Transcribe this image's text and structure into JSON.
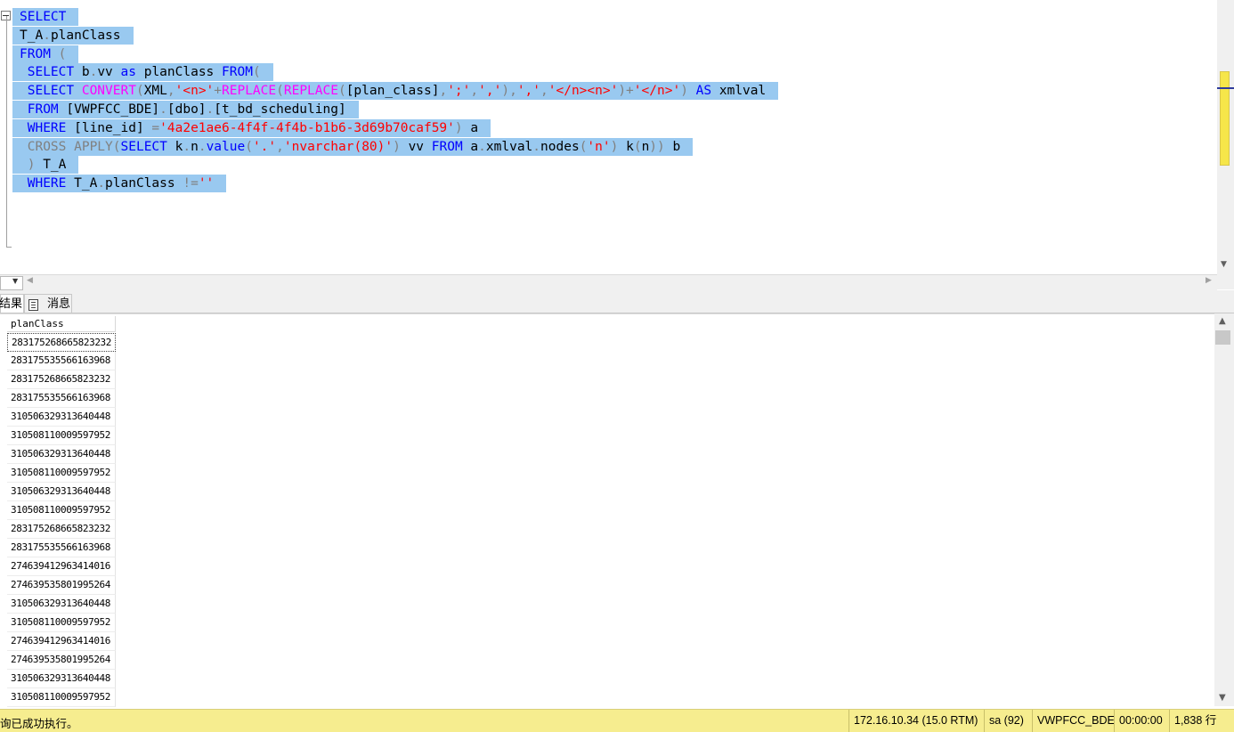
{
  "editor": {
    "lines": [
      [
        {
          "t": "SELECT",
          "c": "kw"
        }
      ],
      [
        {
          "t": "T_A",
          "c": ""
        },
        {
          "t": ".",
          "c": "gr"
        },
        {
          "t": "planClass",
          "c": ""
        }
      ],
      [
        {
          "t": "FROM",
          "c": "kw"
        },
        {
          "t": " (",
          "c": "gr"
        }
      ],
      [
        {
          "t": " SELECT",
          "c": "kw"
        },
        {
          "t": " b",
          "c": ""
        },
        {
          "t": ".",
          "c": "gr"
        },
        {
          "t": "vv ",
          "c": ""
        },
        {
          "t": "as",
          "c": "kw"
        },
        {
          "t": " planClass ",
          "c": ""
        },
        {
          "t": "FROM",
          "c": "kw"
        },
        {
          "t": "(",
          "c": "gr"
        }
      ],
      [
        {
          "t": " SELECT",
          "c": "kw"
        },
        {
          "t": " ",
          "c": ""
        },
        {
          "t": "CONVERT",
          "c": "fn"
        },
        {
          "t": "(",
          "c": "gr"
        },
        {
          "t": "XML",
          "c": ""
        },
        {
          "t": ",",
          "c": "gr"
        },
        {
          "t": "'<n>'",
          "c": "str"
        },
        {
          "t": "+",
          "c": "gr"
        },
        {
          "t": "REPLACE",
          "c": "fn"
        },
        {
          "t": "(",
          "c": "gr"
        },
        {
          "t": "REPLACE",
          "c": "fn"
        },
        {
          "t": "(",
          "c": "gr"
        },
        {
          "t": "[plan_class]",
          "c": ""
        },
        {
          "t": ",",
          "c": "gr"
        },
        {
          "t": "';'",
          "c": "str"
        },
        {
          "t": ",",
          "c": "gr"
        },
        {
          "t": "','",
          "c": "str"
        },
        {
          "t": "),",
          "c": "gr"
        },
        {
          "t": "','",
          "c": "str"
        },
        {
          "t": ",",
          "c": "gr"
        },
        {
          "t": "'</n><n>'",
          "c": "str"
        },
        {
          "t": ")+",
          "c": "gr"
        },
        {
          "t": "'</n>'",
          "c": "str"
        },
        {
          "t": ") ",
          "c": "gr"
        },
        {
          "t": "AS",
          "c": "kw"
        },
        {
          "t": " xmlval",
          "c": ""
        }
      ],
      [
        {
          "t": " FROM",
          "c": "kw"
        },
        {
          "t": " [VWPFCC_BDE]",
          "c": ""
        },
        {
          "t": ".",
          "c": "gr"
        },
        {
          "t": "[dbo]",
          "c": ""
        },
        {
          "t": ".",
          "c": "gr"
        },
        {
          "t": "[t_bd_scheduling]",
          "c": ""
        }
      ],
      [
        {
          "t": " WHERE",
          "c": "kw"
        },
        {
          "t": " [line_id] ",
          "c": ""
        },
        {
          "t": "=",
          "c": "gr"
        },
        {
          "t": "'4a2e1ae6-4f4f-4f4b-b1b6-3d69b70caf59'",
          "c": "str"
        },
        {
          "t": ") ",
          "c": "gr"
        },
        {
          "t": "a",
          "c": ""
        }
      ],
      [
        {
          "t": " CROSS APPLY",
          "c": "gr"
        },
        {
          "t": "(",
          "c": "gr"
        },
        {
          "t": "SELECT",
          "c": "kw"
        },
        {
          "t": " k",
          "c": ""
        },
        {
          "t": ".",
          "c": "gr"
        },
        {
          "t": "n",
          "c": ""
        },
        {
          "t": ".",
          "c": "gr"
        },
        {
          "t": "value",
          "c": "kw"
        },
        {
          "t": "(",
          "c": "gr"
        },
        {
          "t": "'.'",
          "c": "str"
        },
        {
          "t": ",",
          "c": "gr"
        },
        {
          "t": "'nvarchar(80)'",
          "c": "str"
        },
        {
          "t": ") ",
          "c": "gr"
        },
        {
          "t": "vv ",
          "c": ""
        },
        {
          "t": "FROM",
          "c": "kw"
        },
        {
          "t": " a",
          "c": ""
        },
        {
          "t": ".",
          "c": "gr"
        },
        {
          "t": "xmlval",
          "c": ""
        },
        {
          "t": ".",
          "c": "gr"
        },
        {
          "t": "nodes",
          "c": ""
        },
        {
          "t": "(",
          "c": "gr"
        },
        {
          "t": "'n'",
          "c": "str"
        },
        {
          "t": ") ",
          "c": "gr"
        },
        {
          "t": "k",
          "c": ""
        },
        {
          "t": "(",
          "c": "gr"
        },
        {
          "t": "n",
          "c": ""
        },
        {
          "t": ")) ",
          "c": "gr"
        },
        {
          "t": "b",
          "c": ""
        }
      ],
      [
        {
          "t": " ) ",
          "c": "gr"
        },
        {
          "t": "T_A",
          "c": ""
        }
      ],
      [
        {
          "t": " WHERE",
          "c": "kw"
        },
        {
          "t": " T_A",
          "c": ""
        },
        {
          "t": ".",
          "c": "gr"
        },
        {
          "t": "planClass ",
          "c": ""
        },
        {
          "t": "!=",
          "c": "gr"
        },
        {
          "t": "''",
          "c": "str"
        }
      ]
    ]
  },
  "tabs": {
    "results_label": "结果",
    "messages_label": "消息"
  },
  "grid": {
    "column_header": "planClass",
    "rows": [
      "283175268665823232",
      "283175535566163968",
      "283175268665823232",
      "283175535566163968",
      "310506329313640448",
      "310508110009597952",
      "310506329313640448",
      "310508110009597952",
      "310506329313640448",
      "310508110009597952",
      "283175268665823232",
      "283175535566163968",
      "274639412963414016",
      "274639535801995264",
      "310506329313640448",
      "310508110009597952",
      "274639412963414016",
      "274639535801995264",
      "310506329313640448",
      "310508110009597952"
    ]
  },
  "status": {
    "message": "询已成功执行。",
    "server": "172.16.10.34 (15.0 RTM)",
    "user": "sa (92)",
    "database": "VWPFCC_BDE",
    "elapsed": "00:00:00",
    "row_count": "1,838 行"
  },
  "colors": {
    "keyword": "#0000ff",
    "function": "#ff00ff",
    "string": "#ff0000",
    "operator": "#808080",
    "selection": "#99c9f0",
    "status_bar": "#f6ed8f"
  }
}
